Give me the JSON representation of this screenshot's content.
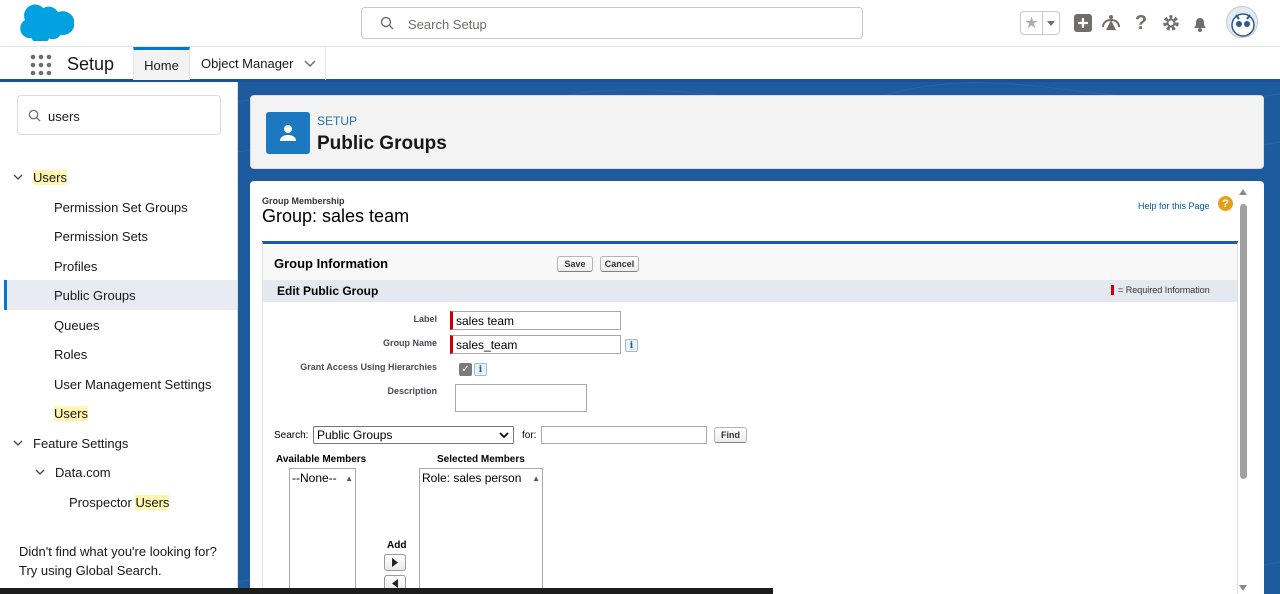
{
  "header": {
    "search_placeholder": "Search Setup"
  },
  "context_nav": {
    "app_name": "Setup",
    "tabs": [
      {
        "label": "Home",
        "selected": true
      },
      {
        "label": "Object Manager"
      }
    ]
  },
  "sidebar": {
    "search_value": "users",
    "tree": {
      "users_section": "Users",
      "items": [
        "Permission Set Groups",
        "Permission Sets",
        "Profiles",
        "Public Groups",
        "Queues",
        "Roles",
        "User Management Settings",
        "Users"
      ],
      "selected_item": "Public Groups",
      "feature_settings": "Feature Settings",
      "datacom": "Data.com",
      "prospector_prefix": "Prospector ",
      "prospector_highlight": "Users"
    },
    "footer_line1": "Didn't find what you're looking for?",
    "footer_line2": "Try using Global Search."
  },
  "page_header": {
    "eyebrow": "SETUP",
    "title": "Public Groups"
  },
  "group_membership": {
    "label": "Group Membership",
    "title": "Group: sales team",
    "help_link": "Help for this Page",
    "help_icon": "?"
  },
  "group_information": {
    "title": "Group Information",
    "save_label": "Save",
    "cancel_label": "Cancel",
    "section_title": "Edit Public Group",
    "required_info": "= Required Information",
    "fields": {
      "label_label": "Label",
      "label_value": "sales team",
      "group_name_label": "Group Name",
      "group_name_value": "sales_team",
      "grant_access_label": "Grant Access Using Hierarchies",
      "grant_access_checked": true,
      "description_label": "Description",
      "description_value": ""
    },
    "info_glyph": "i"
  },
  "member_search": {
    "search_label": "Search:",
    "search_selected": "Public Groups",
    "for_label": "for:",
    "for_value": "",
    "find_label": "Find",
    "available_header": "Available Members",
    "available_items": [
      "--None--"
    ],
    "selected_header": "Selected Members",
    "selected_items": [
      "Role: sales person"
    ],
    "add_label": "Add"
  },
  "colors": {
    "brand_blue": "#0176d3",
    "header_band": "#1e5b9e",
    "highlight": "#fff6b1",
    "required_red": "#cc0000"
  }
}
